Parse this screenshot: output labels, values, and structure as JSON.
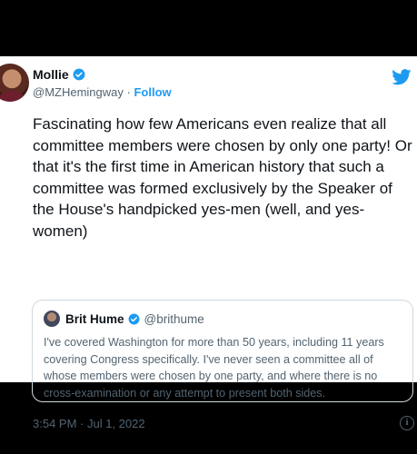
{
  "tweet": {
    "author_name": "Mollie",
    "author_handle": "@MZHemingway",
    "separator": "·",
    "follow_label": "Follow",
    "text": "Fascinating how few Americans even realize that all committee members were chosen by only one party! Or that it's the first time in American history that such a committee was formed exclusively by the Speaker of the House's handpicked yes-men (well, and yes-women)",
    "timestamp": "3:54 PM · Jul 1, 2022",
    "info_glyph": "i"
  },
  "quoted_tweet": {
    "author_name": "Brit Hume",
    "author_handle": "@brithume",
    "text": "I've covered Washington for more than 50 years, including 11 years covering Congress specifically. I've never seen a committee all of whose members were chosen by one party, and where there is no cross-examination or any attempt to present both sides."
  },
  "colors": {
    "accent": "#1d9bf0",
    "secondary_text": "#536471",
    "border": "#cfd9de",
    "background": "#000000"
  },
  "icons": {
    "verified": "verified-badge-icon",
    "brand": "twitter-bird-icon",
    "info": "info-icon"
  }
}
